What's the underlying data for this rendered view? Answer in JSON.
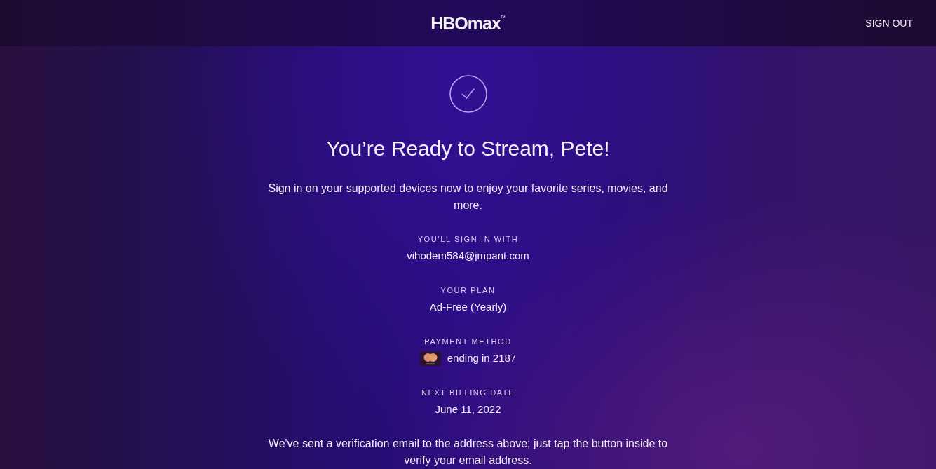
{
  "header": {
    "logo": "HBOmax$^{™}$",
    "sign_out": "SIGN OUT"
  },
  "confirmation": {
    "title": "You’re Ready to Stream, Pete!",
    "message": "Sign in on your supported devices now to enjoy your favorite series, movies, and more."
  },
  "details": [
    {
      "kind": "text",
      "label": "YOU’LL SIGN IN WITH",
      "value": "vihodem584@jmpant.com"
    },
    {
      "kind": "text",
      "label": "YOUR PLAN",
      "value": "Ad-Free (Yearly)"
    },
    {
      "kind": "card",
      "label": "PAYMENT METHOD",
      "value": "ending in 2187"
    },
    {
      "kind": "text",
      "label": "NEXT BILLING DATE",
      "value": "June 11, 2022"
    }
  ],
  "notice": "We've sent a verification email to the address above; just tap the button inside to verify your email address."
}
